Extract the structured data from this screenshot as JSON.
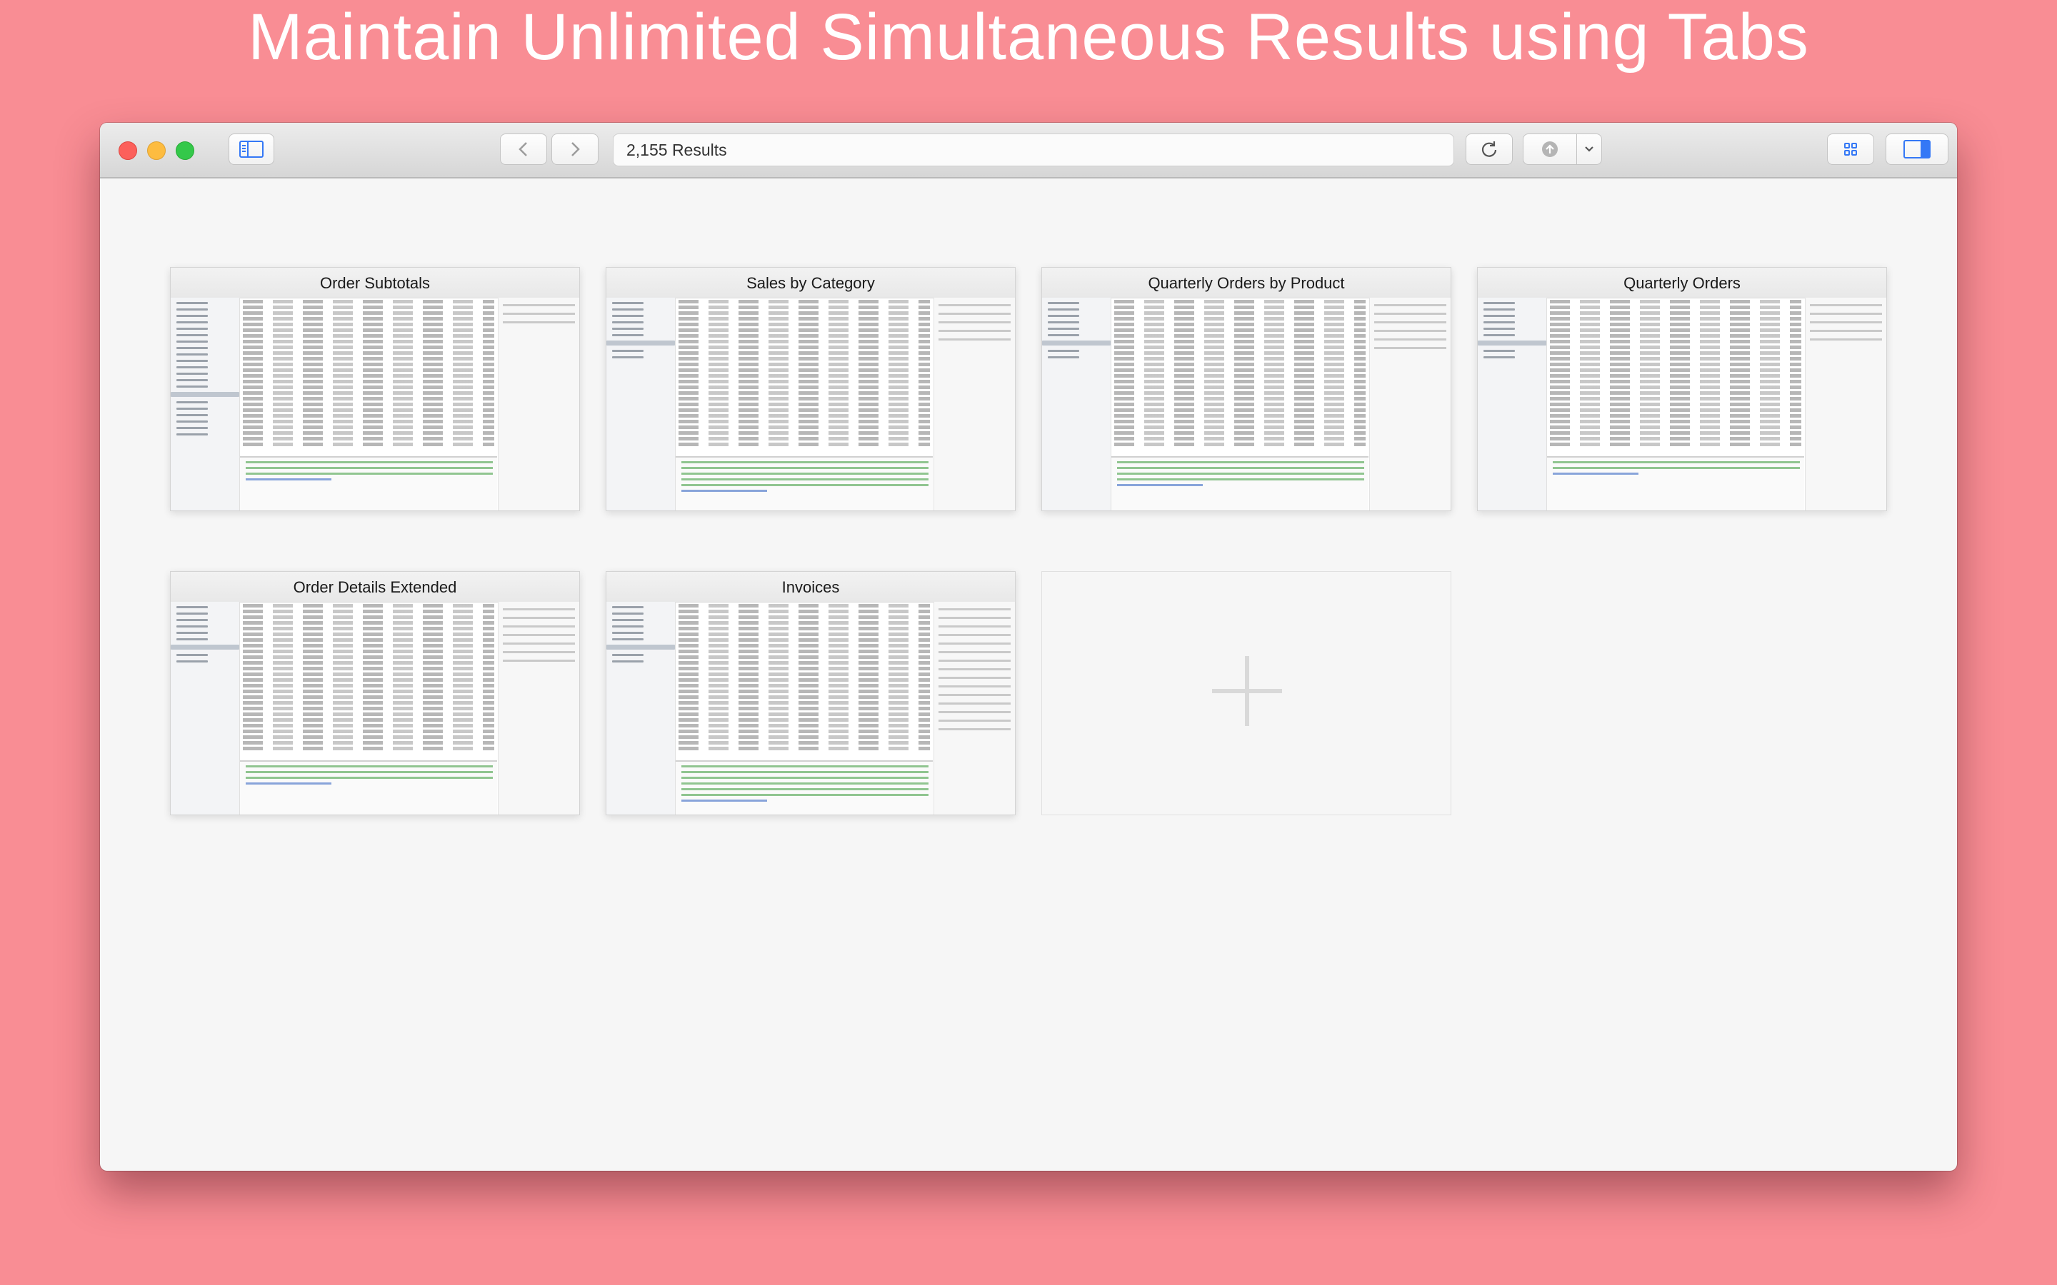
{
  "banner": {
    "title": "Maintain Unlimited Simultaneous Results using Tabs"
  },
  "toolbar": {
    "address_text": "2,155 Results",
    "icons": [
      "sidebar-toggle-icon",
      "back-arrow-icon",
      "forward-arrow-icon",
      "reload-icon",
      "share-icon",
      "dropdown-chevron-icon",
      "tab-overview-icon",
      "inspector-toggle-icon"
    ]
  },
  "tabs": [
    {
      "title": "Order Subtotals"
    },
    {
      "title": "Sales by Category"
    },
    {
      "title": "Quarterly Orders by Product"
    },
    {
      "title": "Quarterly Orders"
    },
    {
      "title": "Order Details Extended"
    },
    {
      "title": "Invoices"
    }
  ],
  "new_tab": {
    "icon": "plus-icon"
  }
}
